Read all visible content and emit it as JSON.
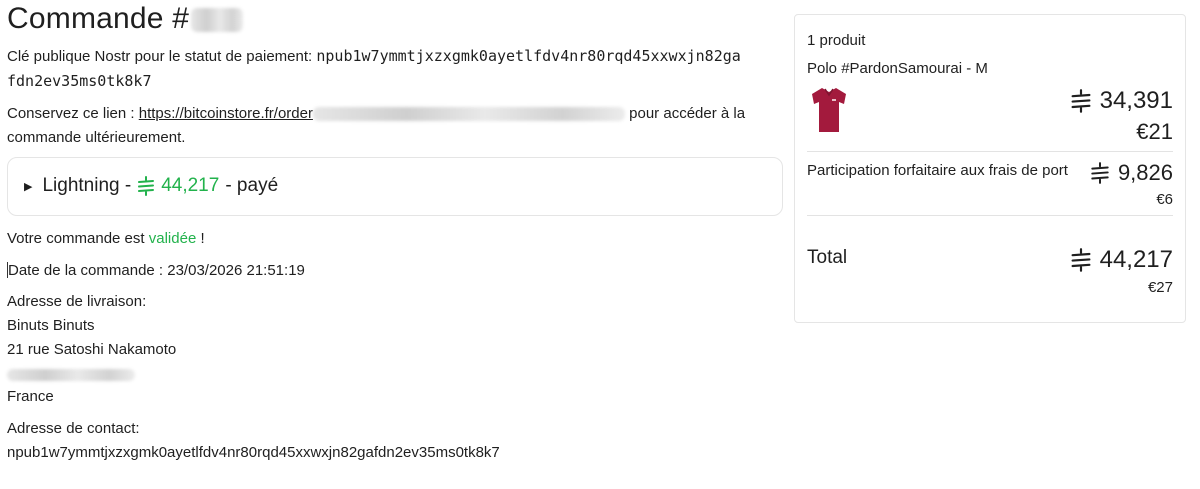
{
  "order": {
    "title": "Commande #",
    "npub_label": "Clé publique Nostr pour le statut de paiement:",
    "npub_line1": "npub1w7ymmtjxzxgmk0ayetlfdv4nr80rqd45xxwxjn82ga",
    "npub_line2": "fdn2ev35ms0tk8k7",
    "keep_link_prefix": "Conservez ce lien :",
    "link_text": "https://bitcoinstore.fr/order",
    "keep_link_suffix": "pour accéder à la",
    "keep_link_suffix2": "commande ultérieurement."
  },
  "payment": {
    "method": "Lightning -",
    "amount": "44,217",
    "status": "- payé"
  },
  "status": {
    "prefix": "Votre commande est",
    "value": "validée",
    "suffix": "!"
  },
  "date_line": "Date de la commande : 23/03/2026 21:51:19",
  "shipping": {
    "label": "Adresse de livraison:",
    "name": "Binuts Binuts",
    "street": "21 rue Satoshi Nakamoto",
    "country": "France"
  },
  "contact": {
    "label": "Adresse de contact:",
    "value": "npub1w7ymmtjxzxgmk0ayetlfdv4nr80rqd45xxwxjn82gafdn2ev35ms0tk8k7"
  },
  "summary": {
    "count": "1 produit",
    "product_name": "Polo #PardonSamourai - M",
    "product_sats": "34,391",
    "product_eur": "€21",
    "shipping_label": "Participation forfaitaire aux frais de port",
    "shipping_sats": "9,826",
    "shipping_eur": "€6",
    "total_label": "Total",
    "total_sats": "44,217",
    "total_eur": "€27"
  },
  "colors": {
    "accent_green": "#22b24c",
    "shirt": "#a31a3d"
  },
  "icons": {
    "sats": "satoshi-symbol-icon",
    "disclosure": "triangle-right-icon",
    "product": "polo-shirt-icon"
  }
}
